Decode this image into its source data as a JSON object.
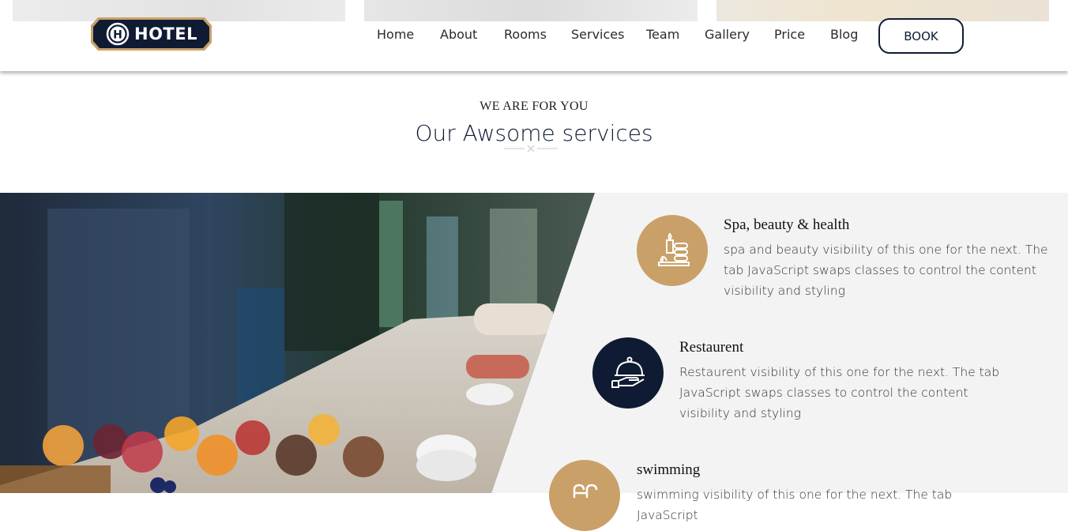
{
  "header": {
    "logo_text": "HOTEL",
    "logo_letter": "H",
    "nav": [
      "Home",
      "About",
      "Rooms",
      "Services",
      "Team",
      "Gallery",
      "Price",
      "Blog"
    ],
    "book_label": "BOOK"
  },
  "section": {
    "eyebrow": "WE ARE FOR YOU",
    "title": "Our Awsome services"
  },
  "services": [
    {
      "title": "Spa, beauty & health",
      "desc": "spa and beauty visibility of this one for the next. The tab JavaScript swaps classes to control the content visibility and styling",
      "icon": "spa-icon",
      "icon_bg": "#c9a068"
    },
    {
      "title": "Restaurent",
      "desc": "Restaurent visibility of this one for the next. The tab JavaScript swaps classes to control the content visibility and styling",
      "icon": "cloche-icon",
      "icon_bg": "#0f1b33"
    },
    {
      "title": "swimming",
      "desc": "swimming visibility of this one for the next. The tab JavaScript",
      "icon": "swimming-icon",
      "icon_bg": "#c9a068"
    }
  ],
  "colors": {
    "navy": "#0f1b33",
    "gold": "#c9a068",
    "panel": "#f3f3f3"
  }
}
